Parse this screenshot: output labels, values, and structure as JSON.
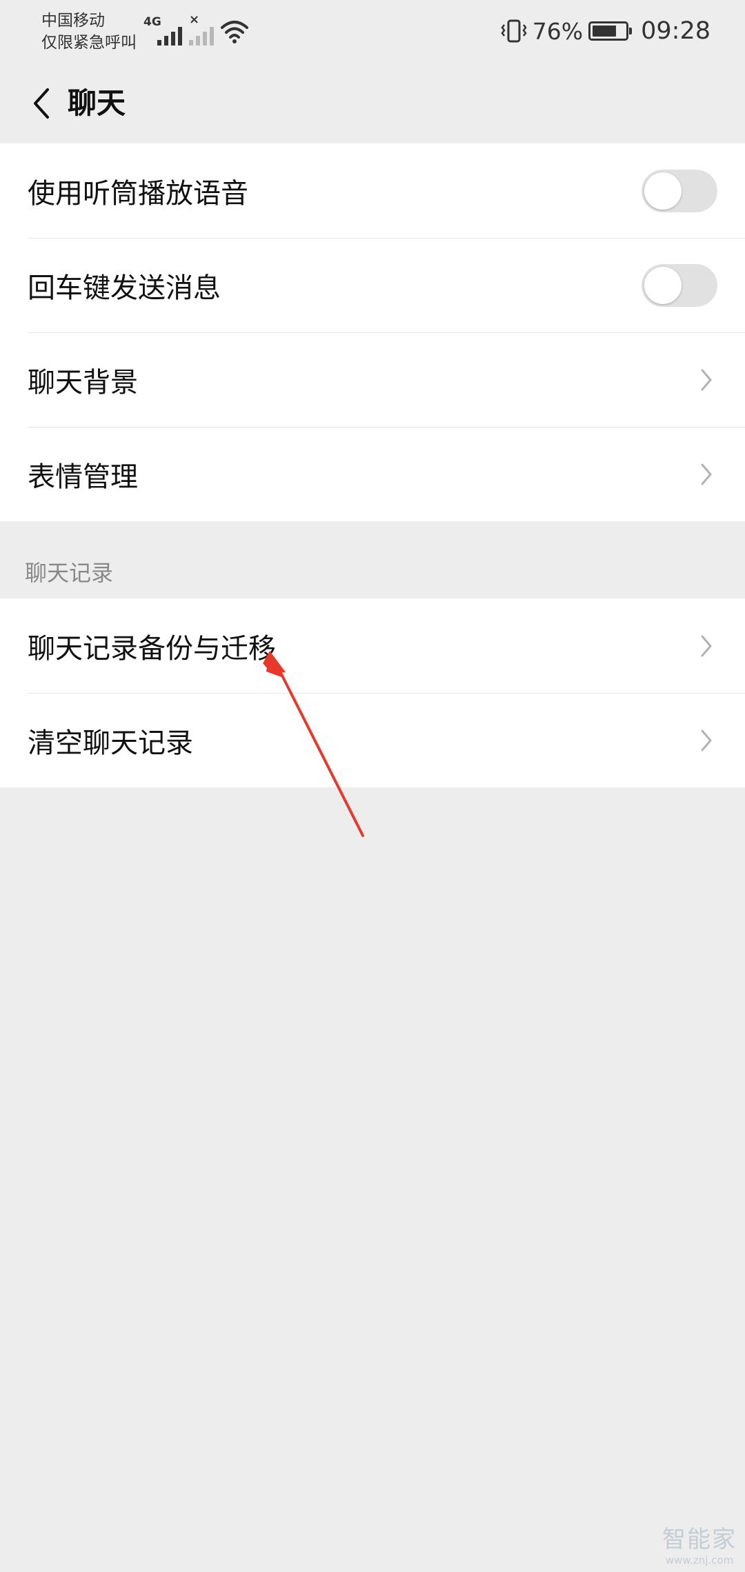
{
  "status_bar": {
    "carrier_line1": "中国移动",
    "carrier_line2": "仅限紧急呼叫",
    "network_type": "4G",
    "battery_percent_text": "76%",
    "battery_level": 0.76,
    "time": "09:28"
  },
  "nav": {
    "title": "聊天"
  },
  "group1": {
    "items": [
      {
        "label": "使用听筒播放语音",
        "control": "toggle",
        "on": false
      },
      {
        "label": "回车键发送消息",
        "control": "toggle",
        "on": false
      },
      {
        "label": "聊天背景",
        "control": "chevron"
      },
      {
        "label": "表情管理",
        "control": "chevron"
      }
    ]
  },
  "section_header": "聊天记录",
  "group2": {
    "items": [
      {
        "label": "聊天记录备份与迁移",
        "control": "chevron"
      },
      {
        "label": "清空聊天记录",
        "control": "chevron"
      }
    ]
  },
  "watermark": {
    "text": "智能家",
    "url": "www.znj.com"
  },
  "colors": {
    "background": "#ededed",
    "card": "#ffffff",
    "toggle_off": "#e1e1e1",
    "annotation_arrow": "#e8382c"
  },
  "icons": [
    "back-arrow-icon",
    "chevron-right-icon",
    "vibrate-icon",
    "battery-icon",
    "wifi-icon",
    "signal-icon"
  ]
}
